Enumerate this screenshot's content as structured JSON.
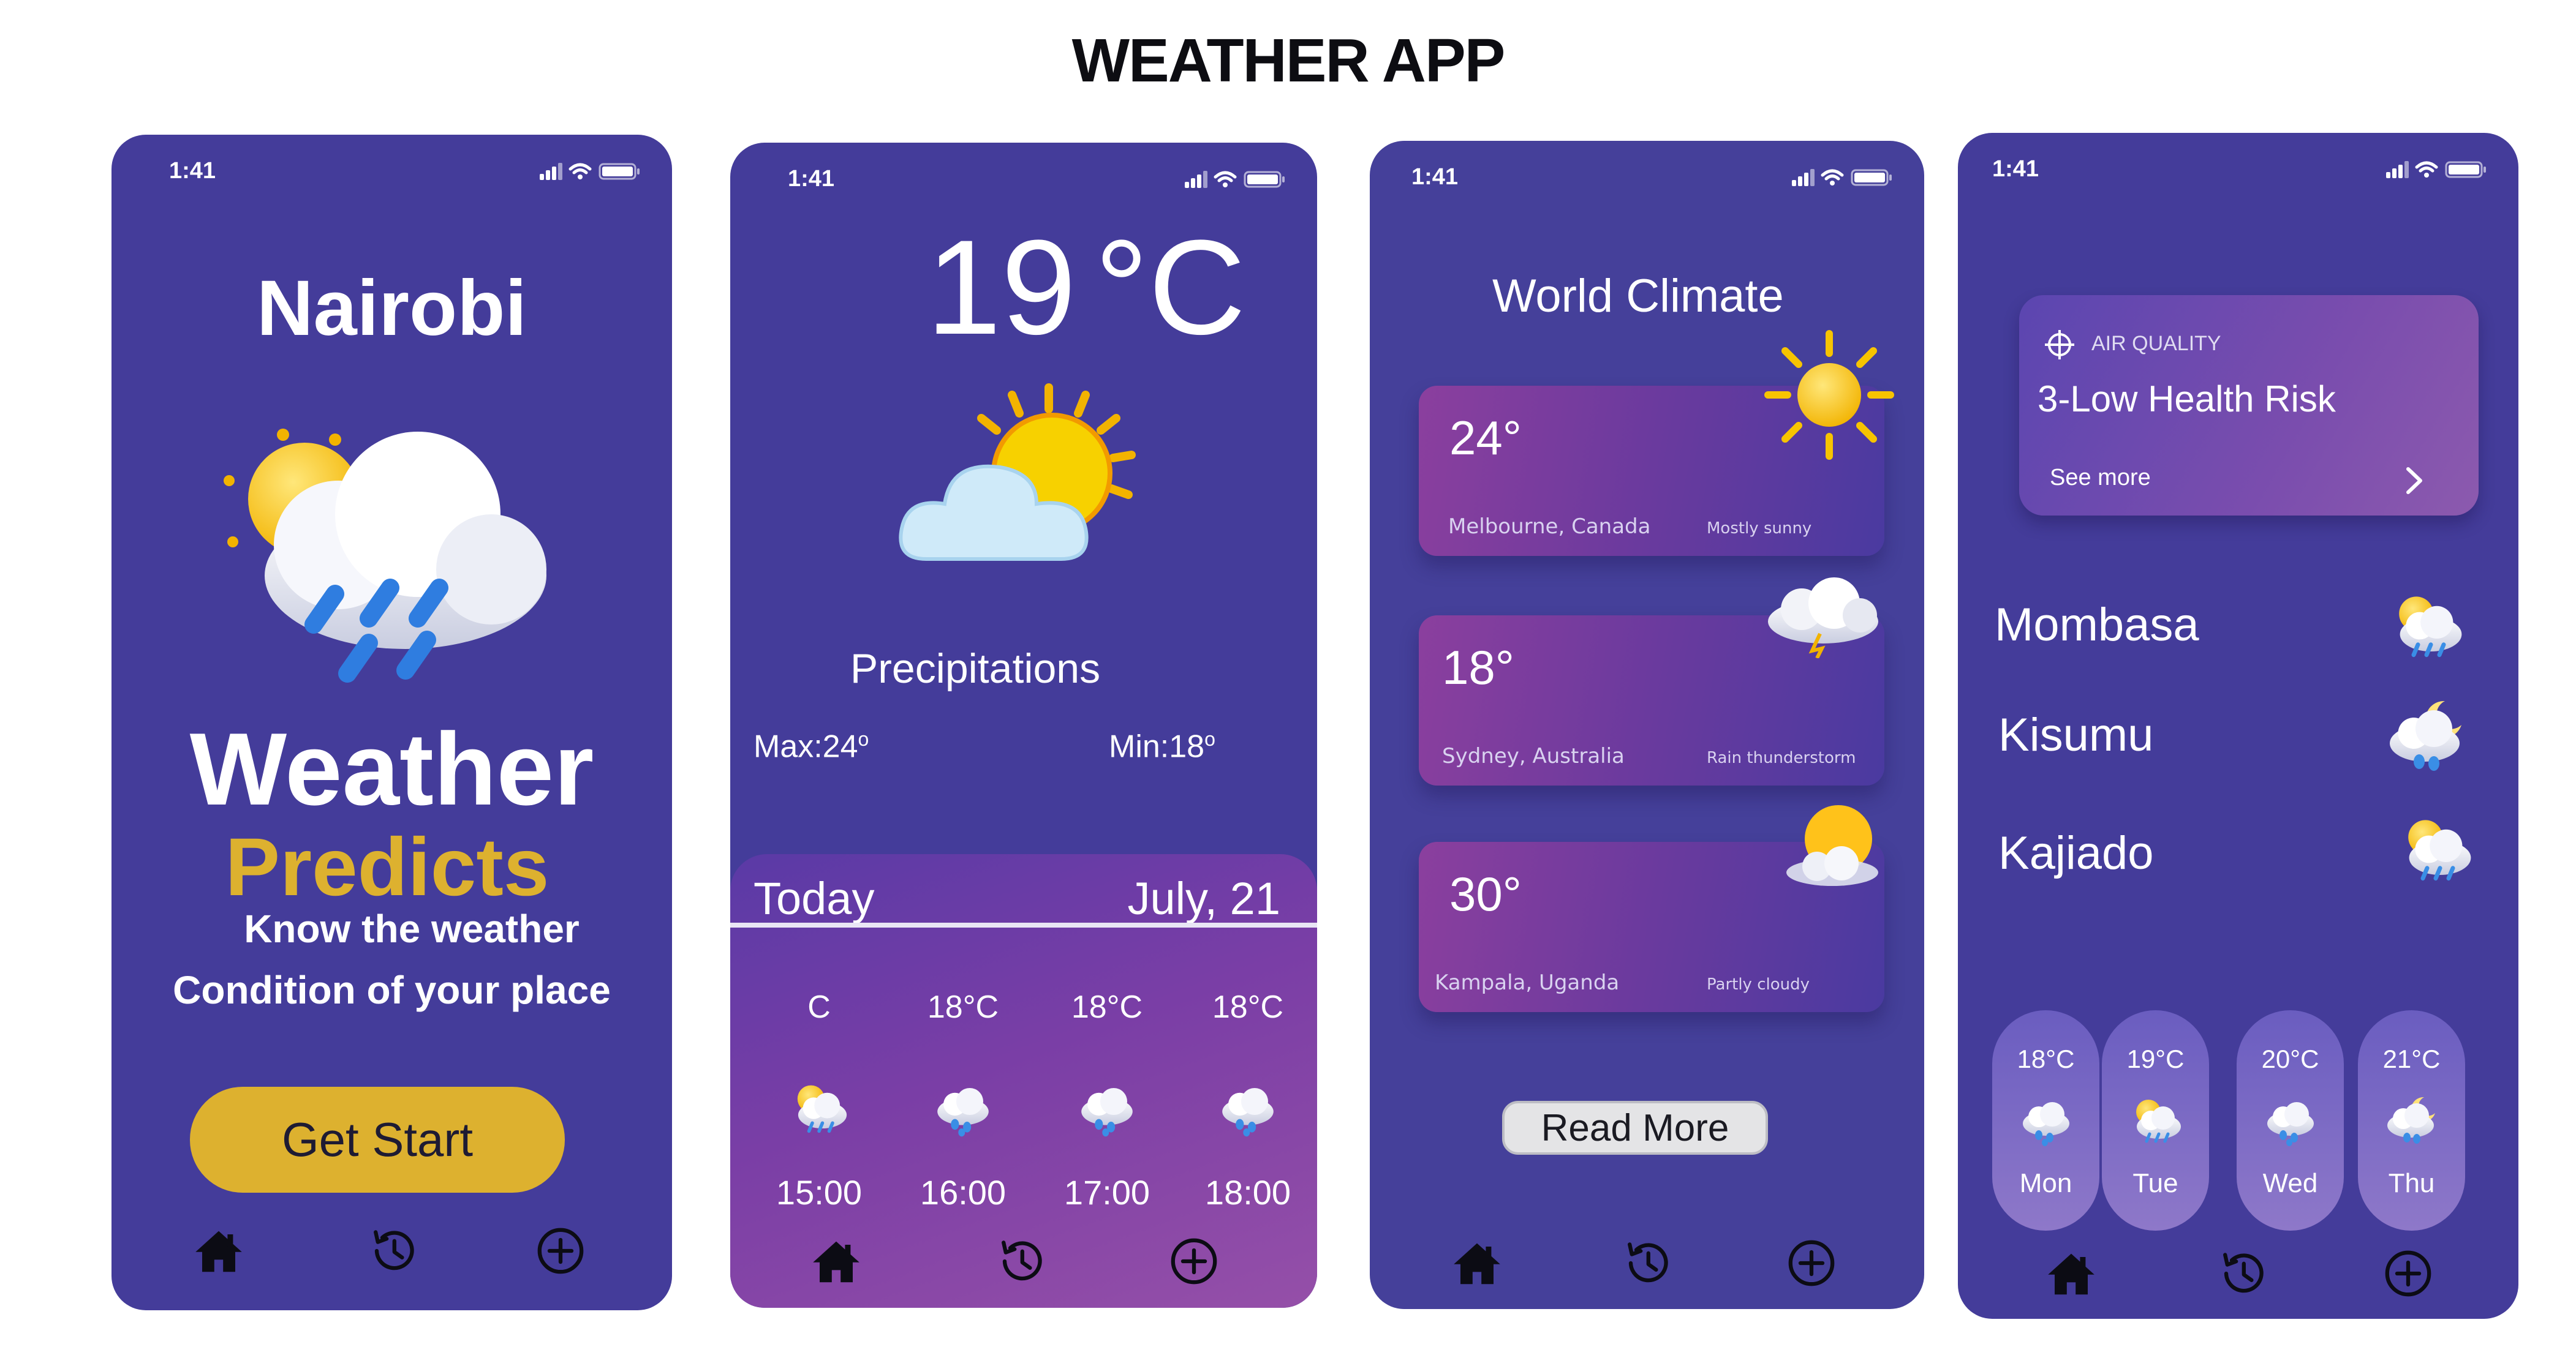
{
  "page_title": "WEATHER APP",
  "status_time": "1:41",
  "screen1": {
    "city": "Nairobi",
    "headline1": "Weather",
    "headline2": "Predicts",
    "tagline1": "Know the weather",
    "tagline2": "Condition of your place",
    "cta": "Get Start",
    "icon": "sun-cloud-rain-icon"
  },
  "screen2": {
    "temperature": "19",
    "unit": "°C",
    "label": "Precipitations",
    "max": "Max:24",
    "min": "Min:18",
    "degree_sup": "o",
    "today": "Today",
    "date": "July, 21",
    "hours": [
      {
        "temp": "C",
        "time": "15:00",
        "icon": "sun-cloud-rain-icon"
      },
      {
        "temp": "18",
        "time": "16:00",
        "icon": "cloud-rain-icon"
      },
      {
        "temp": "18",
        "time": "17:00",
        "icon": "cloud-rain-icon"
      },
      {
        "temp": "18",
        "time": "18:00",
        "icon": "cloud-rain-icon"
      }
    ],
    "deg_c": "°C"
  },
  "screen3": {
    "title": "World Climate",
    "cards": [
      {
        "temp": "24°",
        "city": "Melbourne, Canada",
        "condition": "Mostly sunny",
        "icon": "sun-icon"
      },
      {
        "temp": "18°",
        "city": "Sydney, Australia",
        "condition": "Rain thunderstorm",
        "icon": "storm-cloud-icon"
      },
      {
        "temp": "30°",
        "city": "Kampala, Uganda",
        "condition": "Partly cloudy",
        "icon": "sun-cloud-icon"
      }
    ],
    "read_more": "Read More"
  },
  "screen4": {
    "air_quality_label": "AIR QUALITY",
    "air_quality_value": "3-Low Health Risk",
    "see_more": "See more",
    "peek_text": "Tue",
    "cities": [
      {
        "name": "Mombasa",
        "icon": "sun-cloud-rain-icon"
      },
      {
        "name": "Kisumu",
        "icon": "moon-cloud-rain-icon"
      },
      {
        "name": "Kajiado",
        "icon": "sun-cloud-rain-icon"
      }
    ],
    "forecast": [
      {
        "temp": "18°C",
        "day": "Mon"
      },
      {
        "temp": "19°C",
        "day": "Tue"
      },
      {
        "temp": "20°C",
        "day": "Wed"
      },
      {
        "temp": "21°C",
        "day": "Thu"
      }
    ]
  },
  "nav": [
    "home-icon",
    "history-icon",
    "add-circle-icon"
  ],
  "colors": {
    "background": "#443c9a",
    "accent": "#ddb12f"
  }
}
